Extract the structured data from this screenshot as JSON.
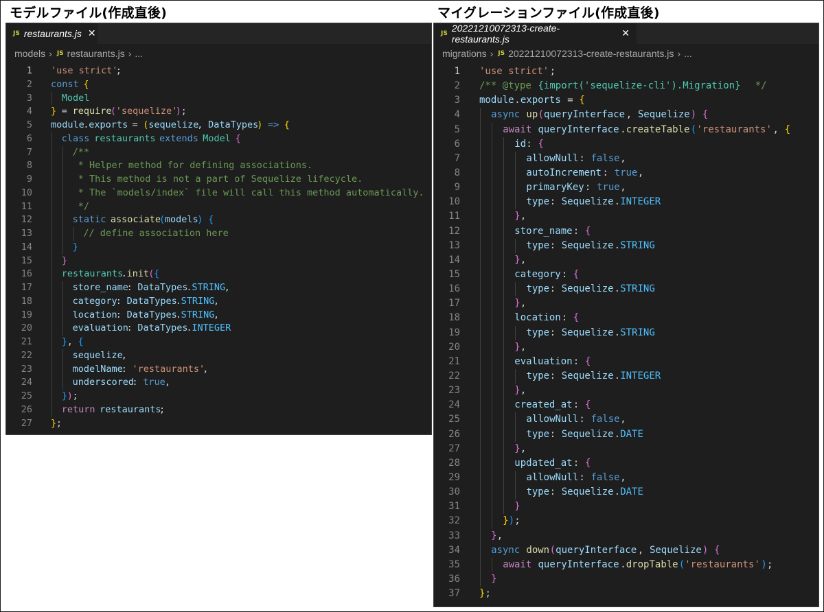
{
  "titles": {
    "model": "モデルファイル(作成直後)",
    "migration": "マイグレーションファイル(作成直後)"
  },
  "left_editor": {
    "tab": {
      "badge": "JS",
      "filename": "restaurants.js",
      "close": "✕"
    },
    "breadcrumb": {
      "folder": "models",
      "badge": "JS",
      "file": "restaurants.js",
      "more": "..."
    },
    "lines": [
      [
        [
          0,
          "str",
          "'use strict'"
        ],
        [
          12,
          "pl",
          ";"
        ]
      ],
      [
        [
          0,
          "kw",
          "const"
        ],
        [
          6,
          "p1",
          "{"
        ]
      ],
      [
        [
          2,
          "cls",
          "Model"
        ]
      ],
      [
        [
          0,
          "p1",
          "}"
        ],
        [
          2,
          "pl",
          "= "
        ],
        [
          4,
          "fn",
          "require"
        ],
        [
          11,
          "p2",
          "("
        ],
        [
          12,
          "str",
          "'sequelize'"
        ],
        [
          23,
          "p2",
          ")"
        ],
        [
          24,
          "pl",
          ";"
        ]
      ],
      [
        [
          0,
          "var",
          "module"
        ],
        [
          6,
          "pl",
          "."
        ],
        [
          7,
          "var",
          "exports"
        ],
        [
          15,
          "pl",
          "= "
        ],
        [
          17,
          "p1",
          "("
        ],
        [
          18,
          "var",
          "sequelize"
        ],
        [
          27,
          "pl",
          ", "
        ],
        [
          29,
          "var",
          "DataTypes"
        ],
        [
          38,
          "p1",
          ")"
        ],
        [
          40,
          "kw",
          "=>"
        ],
        [
          43,
          "p1",
          "{"
        ]
      ],
      [
        [
          2,
          "kw",
          "class"
        ],
        [
          8,
          "cls",
          "restaurants"
        ],
        [
          20,
          "kw",
          "extends"
        ],
        [
          28,
          "cls",
          "Model"
        ],
        [
          34,
          "p2",
          "{"
        ]
      ],
      [
        [
          4,
          "com",
          "/**"
        ]
      ],
      [
        [
          4,
          "com",
          " * Helper method for defining associations."
        ]
      ],
      [
        [
          4,
          "com",
          " * This method is not a part of Sequelize lifecycle."
        ]
      ],
      [
        [
          4,
          "com",
          " * The `models/index` file will call this method automatically."
        ]
      ],
      [
        [
          4,
          "com",
          " */"
        ]
      ],
      [
        [
          4,
          "kw",
          "static"
        ],
        [
          11,
          "fn",
          "associate"
        ],
        [
          20,
          "p3",
          "("
        ],
        [
          21,
          "var",
          "models"
        ],
        [
          27,
          "p3",
          ")"
        ],
        [
          29,
          "p3",
          "{"
        ]
      ],
      [
        [
          6,
          "com",
          "// define association here"
        ]
      ],
      [
        [
          4,
          "p3",
          "}"
        ]
      ],
      [
        [
          2,
          "p2",
          "}"
        ]
      ],
      [
        [
          2,
          "cls",
          "restaurants"
        ],
        [
          13,
          "pl",
          "."
        ],
        [
          14,
          "fn",
          "init"
        ],
        [
          18,
          "p2",
          "("
        ],
        [
          19,
          "p3",
          "{"
        ]
      ],
      [
        [
          4,
          "var",
          "store_name"
        ],
        [
          14,
          "pl",
          ": "
        ],
        [
          16,
          "var",
          "DataTypes"
        ],
        [
          25,
          "pl",
          "."
        ],
        [
          26,
          "cst",
          "STRING"
        ],
        [
          32,
          "pl",
          ","
        ]
      ],
      [
        [
          4,
          "var",
          "category"
        ],
        [
          12,
          "pl",
          ": "
        ],
        [
          14,
          "var",
          "DataTypes"
        ],
        [
          23,
          "pl",
          "."
        ],
        [
          24,
          "cst",
          "STRING"
        ],
        [
          30,
          "pl",
          ","
        ]
      ],
      [
        [
          4,
          "var",
          "location"
        ],
        [
          12,
          "pl",
          ": "
        ],
        [
          14,
          "var",
          "DataTypes"
        ],
        [
          23,
          "pl",
          "."
        ],
        [
          24,
          "cst",
          "STRING"
        ],
        [
          30,
          "pl",
          ","
        ]
      ],
      [
        [
          4,
          "var",
          "evaluation"
        ],
        [
          14,
          "pl",
          ": "
        ],
        [
          16,
          "var",
          "DataTypes"
        ],
        [
          25,
          "pl",
          "."
        ],
        [
          26,
          "cst",
          "INTEGER"
        ]
      ],
      [
        [
          2,
          "p3",
          "}"
        ],
        [
          3,
          "pl",
          ", "
        ],
        [
          5,
          "p3",
          "{"
        ]
      ],
      [
        [
          4,
          "var",
          "sequelize"
        ],
        [
          13,
          "pl",
          ","
        ]
      ],
      [
        [
          4,
          "var",
          "modelName"
        ],
        [
          13,
          "pl",
          ": "
        ],
        [
          15,
          "str",
          "'restaurants'"
        ],
        [
          28,
          "pl",
          ","
        ]
      ],
      [
        [
          4,
          "var",
          "underscored"
        ],
        [
          15,
          "pl",
          ": "
        ],
        [
          17,
          "kw",
          "true"
        ],
        [
          21,
          "pl",
          ","
        ]
      ],
      [
        [
          2,
          "p3",
          "}"
        ],
        [
          3,
          "p2",
          ")"
        ],
        [
          4,
          "pl",
          ";"
        ]
      ],
      [
        [
          2,
          "ctl",
          "return"
        ],
        [
          9,
          "var",
          "restaurants"
        ],
        [
          20,
          "pl",
          ";"
        ]
      ],
      [
        [
          0,
          "p1",
          "}"
        ],
        [
          1,
          "pl",
          ";"
        ]
      ]
    ]
  },
  "right_editor": {
    "tab": {
      "badge": "JS",
      "filename": "20221210072313-create-restaurants.js",
      "close": "✕"
    },
    "breadcrumb": {
      "folder": "migrations",
      "badge": "JS",
      "file": "20221210072313-create-restaurants.js",
      "more": "..."
    },
    "lines": [
      [
        [
          0,
          "str",
          "'use strict'"
        ],
        [
          12,
          "pl",
          ";"
        ]
      ],
      [
        [
          0,
          "com",
          "/** @type "
        ],
        [
          10,
          "cls",
          "{import('sequelize-cli').Migration}"
        ],
        [
          46,
          "com",
          " */"
        ]
      ],
      [
        [
          0,
          "var",
          "module"
        ],
        [
          6,
          "pl",
          "."
        ],
        [
          7,
          "var",
          "exports"
        ],
        [
          15,
          "pl",
          "= "
        ],
        [
          17,
          "p1",
          "{"
        ]
      ],
      [
        [
          2,
          "kw",
          "async"
        ],
        [
          8,
          "fn",
          "up"
        ],
        [
          10,
          "p2",
          "("
        ],
        [
          11,
          "var",
          "queryInterface"
        ],
        [
          25,
          "pl",
          ", "
        ],
        [
          27,
          "var",
          "Sequelize"
        ],
        [
          36,
          "p2",
          ")"
        ],
        [
          38,
          "p2",
          "{"
        ]
      ],
      [
        [
          4,
          "ctl",
          "await"
        ],
        [
          10,
          "var",
          "queryInterface"
        ],
        [
          24,
          "pl",
          "."
        ],
        [
          25,
          "fn",
          "createTable"
        ],
        [
          36,
          "p3",
          "("
        ],
        [
          37,
          "str",
          "'restaurants'"
        ],
        [
          50,
          "pl",
          ", "
        ],
        [
          52,
          "p1",
          "{"
        ]
      ],
      [
        [
          6,
          "var",
          "id"
        ],
        [
          8,
          "pl",
          ": "
        ],
        [
          10,
          "p2",
          "{"
        ]
      ],
      [
        [
          8,
          "var",
          "allowNull"
        ],
        [
          17,
          "pl",
          ": "
        ],
        [
          19,
          "kw",
          "false"
        ],
        [
          24,
          "pl",
          ","
        ]
      ],
      [
        [
          8,
          "var",
          "autoIncrement"
        ],
        [
          21,
          "pl",
          ": "
        ],
        [
          23,
          "kw",
          "true"
        ],
        [
          27,
          "pl",
          ","
        ]
      ],
      [
        [
          8,
          "var",
          "primaryKey"
        ],
        [
          18,
          "pl",
          ": "
        ],
        [
          20,
          "kw",
          "true"
        ],
        [
          24,
          "pl",
          ","
        ]
      ],
      [
        [
          8,
          "var",
          "type"
        ],
        [
          12,
          "pl",
          ": "
        ],
        [
          14,
          "var",
          "Sequelize"
        ],
        [
          23,
          "pl",
          "."
        ],
        [
          24,
          "cst",
          "INTEGER"
        ]
      ],
      [
        [
          6,
          "p2",
          "}"
        ],
        [
          7,
          "pl",
          ","
        ]
      ],
      [
        [
          6,
          "var",
          "store_name"
        ],
        [
          16,
          "pl",
          ": "
        ],
        [
          18,
          "p2",
          "{"
        ]
      ],
      [
        [
          8,
          "var",
          "type"
        ],
        [
          12,
          "pl",
          ": "
        ],
        [
          14,
          "var",
          "Sequelize"
        ],
        [
          23,
          "pl",
          "."
        ],
        [
          24,
          "cst",
          "STRING"
        ]
      ],
      [
        [
          6,
          "p2",
          "}"
        ],
        [
          7,
          "pl",
          ","
        ]
      ],
      [
        [
          6,
          "var",
          "category"
        ],
        [
          14,
          "pl",
          ": "
        ],
        [
          16,
          "p2",
          "{"
        ]
      ],
      [
        [
          8,
          "var",
          "type"
        ],
        [
          12,
          "pl",
          ": "
        ],
        [
          14,
          "var",
          "Sequelize"
        ],
        [
          23,
          "pl",
          "."
        ],
        [
          24,
          "cst",
          "STRING"
        ]
      ],
      [
        [
          6,
          "p2",
          "}"
        ],
        [
          7,
          "pl",
          ","
        ]
      ],
      [
        [
          6,
          "var",
          "location"
        ],
        [
          14,
          "pl",
          ": "
        ],
        [
          16,
          "p2",
          "{"
        ]
      ],
      [
        [
          8,
          "var",
          "type"
        ],
        [
          12,
          "pl",
          ": "
        ],
        [
          14,
          "var",
          "Sequelize"
        ],
        [
          23,
          "pl",
          "."
        ],
        [
          24,
          "cst",
          "STRING"
        ]
      ],
      [
        [
          6,
          "p2",
          "}"
        ],
        [
          7,
          "pl",
          ","
        ]
      ],
      [
        [
          6,
          "var",
          "evaluation"
        ],
        [
          16,
          "pl",
          ": "
        ],
        [
          18,
          "p2",
          "{"
        ]
      ],
      [
        [
          8,
          "var",
          "type"
        ],
        [
          12,
          "pl",
          ": "
        ],
        [
          14,
          "var",
          "Sequelize"
        ],
        [
          23,
          "pl",
          "."
        ],
        [
          24,
          "cst",
          "INTEGER"
        ]
      ],
      [
        [
          6,
          "p2",
          "}"
        ],
        [
          7,
          "pl",
          ","
        ]
      ],
      [
        [
          6,
          "var",
          "created_at"
        ],
        [
          16,
          "pl",
          ": "
        ],
        [
          18,
          "p2",
          "{"
        ]
      ],
      [
        [
          8,
          "var",
          "allowNull"
        ],
        [
          17,
          "pl",
          ": "
        ],
        [
          19,
          "kw",
          "false"
        ],
        [
          24,
          "pl",
          ","
        ]
      ],
      [
        [
          8,
          "var",
          "type"
        ],
        [
          12,
          "pl",
          ": "
        ],
        [
          14,
          "var",
          "Sequelize"
        ],
        [
          23,
          "pl",
          "."
        ],
        [
          24,
          "cst",
          "DATE"
        ]
      ],
      [
        [
          6,
          "p2",
          "}"
        ],
        [
          7,
          "pl",
          ","
        ]
      ],
      [
        [
          6,
          "var",
          "updated_at"
        ],
        [
          16,
          "pl",
          ": "
        ],
        [
          18,
          "p2",
          "{"
        ]
      ],
      [
        [
          8,
          "var",
          "allowNull"
        ],
        [
          17,
          "pl",
          ": "
        ],
        [
          19,
          "kw",
          "false"
        ],
        [
          24,
          "pl",
          ","
        ]
      ],
      [
        [
          8,
          "var",
          "type"
        ],
        [
          12,
          "pl",
          ": "
        ],
        [
          14,
          "var",
          "Sequelize"
        ],
        [
          23,
          "pl",
          "."
        ],
        [
          24,
          "cst",
          "DATE"
        ]
      ],
      [
        [
          6,
          "p2",
          "}"
        ]
      ],
      [
        [
          4,
          "p1",
          "}"
        ],
        [
          5,
          "p3",
          ")"
        ],
        [
          6,
          "pl",
          ";"
        ]
      ],
      [
        [
          2,
          "p2",
          "}"
        ],
        [
          3,
          "pl",
          ","
        ]
      ],
      [
        [
          2,
          "kw",
          "async"
        ],
        [
          8,
          "fn",
          "down"
        ],
        [
          12,
          "p2",
          "("
        ],
        [
          13,
          "var",
          "queryInterface"
        ],
        [
          27,
          "pl",
          ", "
        ],
        [
          29,
          "var",
          "Sequelize"
        ],
        [
          38,
          "p2",
          ")"
        ],
        [
          40,
          "p2",
          "{"
        ]
      ],
      [
        [
          4,
          "ctl",
          "await"
        ],
        [
          10,
          "var",
          "queryInterface"
        ],
        [
          24,
          "pl",
          "."
        ],
        [
          25,
          "fn",
          "dropTable"
        ],
        [
          34,
          "p3",
          "("
        ],
        [
          35,
          "str",
          "'restaurants'"
        ],
        [
          48,
          "p3",
          ")"
        ],
        [
          49,
          "pl",
          ";"
        ]
      ],
      [
        [
          2,
          "p2",
          "}"
        ]
      ],
      [
        [
          0,
          "p1",
          "}"
        ],
        [
          1,
          "pl",
          ";"
        ]
      ]
    ]
  }
}
